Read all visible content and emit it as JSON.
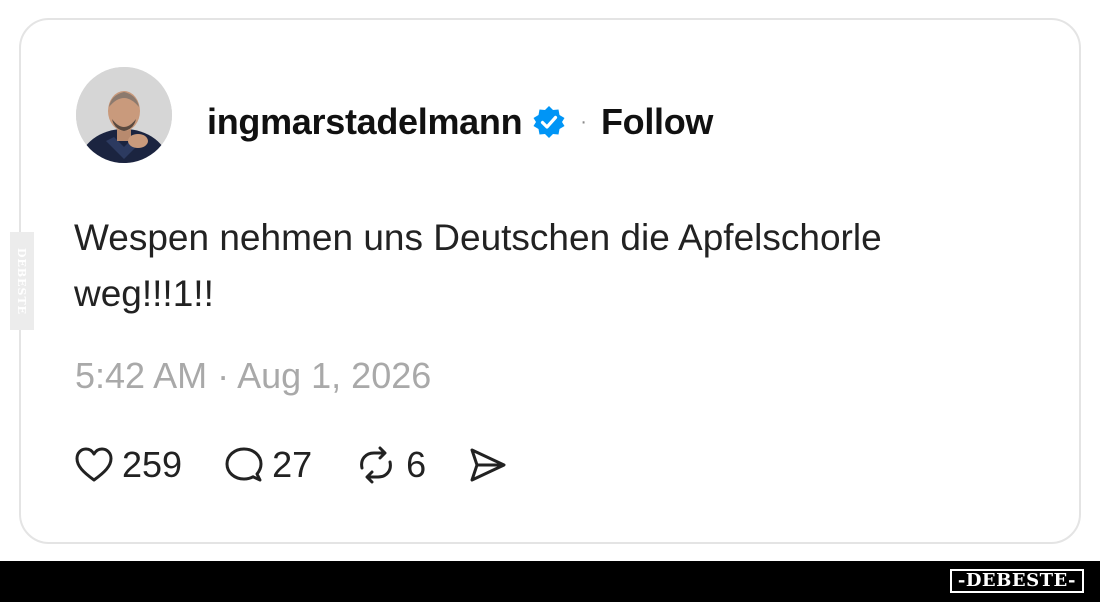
{
  "post": {
    "username": "ingmarstadelmann",
    "separator": "·",
    "follow_label": "Follow",
    "text": "Wespen nehmen uns Deutschen die Apfelschorle weg!!!1!!",
    "timestamp": "5:42 AM · Aug 1, 2026"
  },
  "actions": {
    "likes": "259",
    "replies": "27",
    "reposts": "6"
  },
  "icons": {
    "verified": "verified-badge-icon",
    "like": "heart-icon",
    "reply": "speech-bubble-icon",
    "repost": "repost-arrows-icon",
    "share": "paper-plane-icon"
  },
  "colors": {
    "verified_blue": "#0095f6",
    "text": "#222222",
    "muted": "#a9a9a9",
    "card_border": "#e4e4e4"
  },
  "watermark": {
    "side_text": "DEBESTE",
    "logo_text": "-DEBESTE-"
  }
}
